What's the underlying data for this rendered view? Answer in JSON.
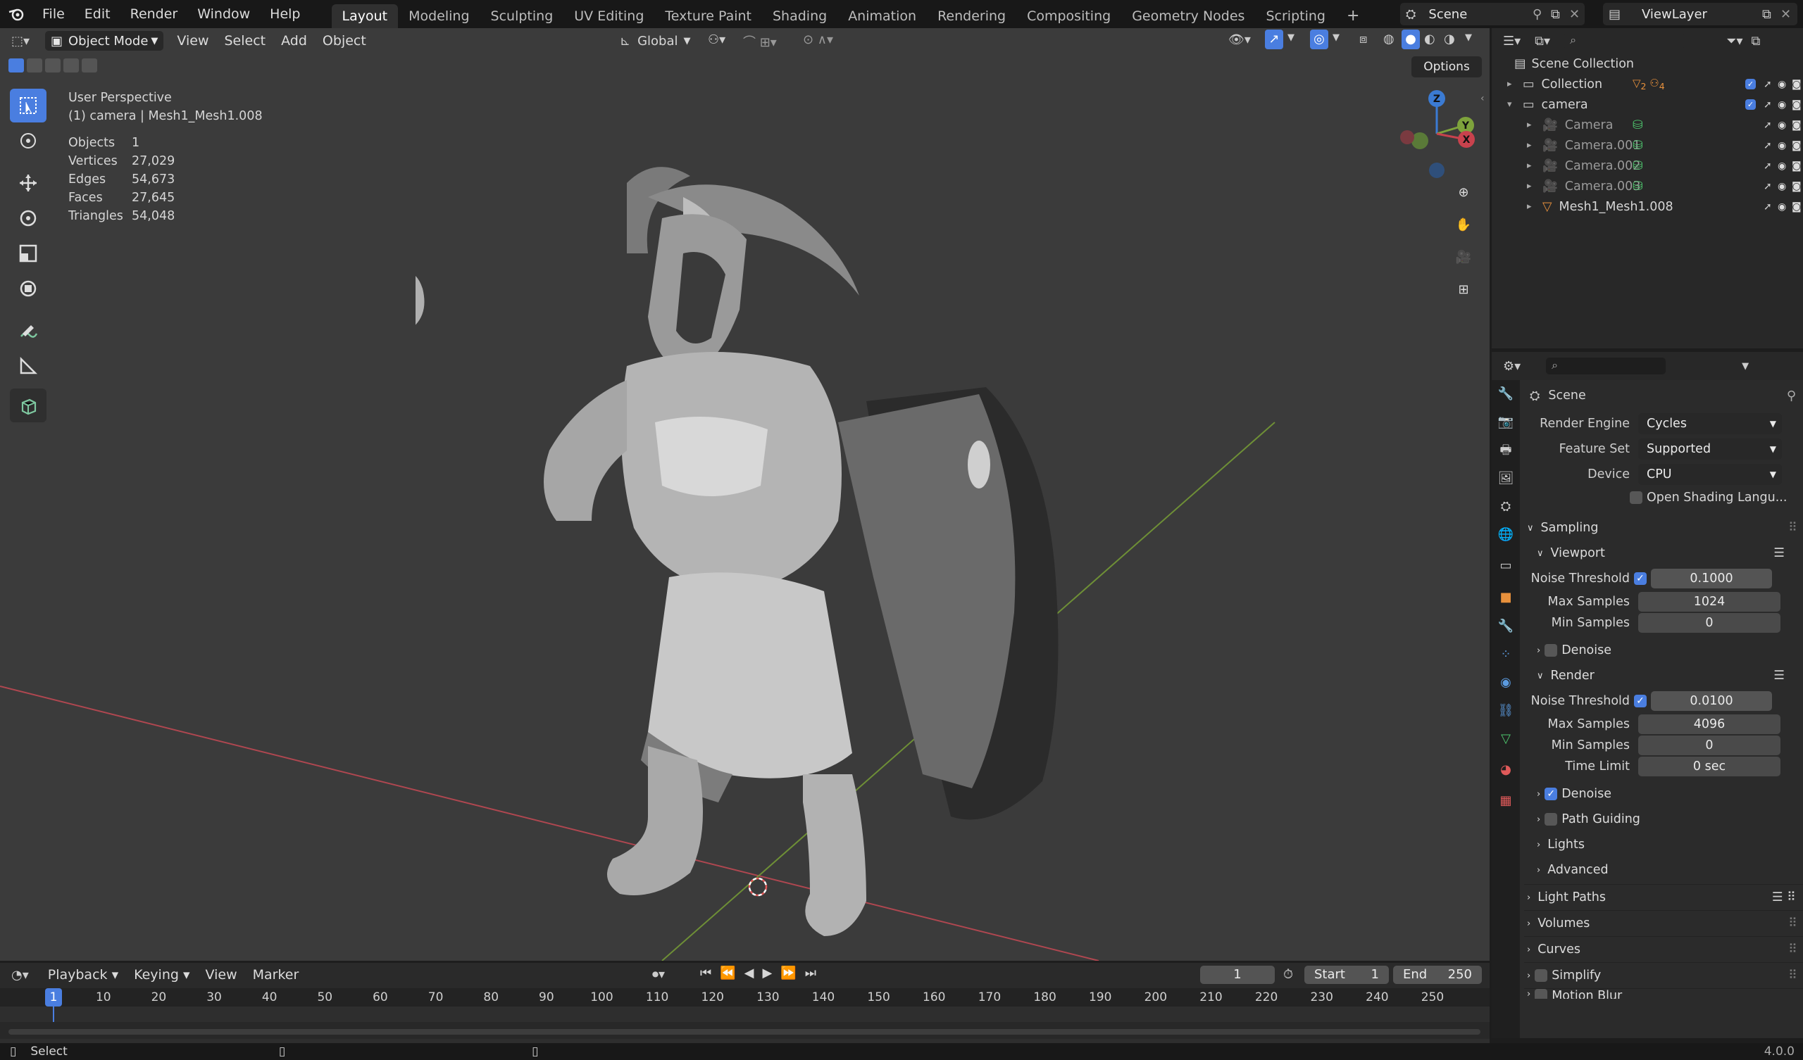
{
  "menu": [
    "File",
    "Edit",
    "Render",
    "Window",
    "Help"
  ],
  "workspaces": [
    "Layout",
    "Modeling",
    "Sculpting",
    "UV Editing",
    "Texture Paint",
    "Shading",
    "Animation",
    "Rendering",
    "Compositing",
    "Geometry Nodes",
    "Scripting"
  ],
  "active_workspace": "Layout",
  "scene_name": "Scene",
  "view_layer": "ViewLayer",
  "viewport": {
    "mode": "Object Mode",
    "menus": [
      "View",
      "Select",
      "Add",
      "Object"
    ],
    "orientation": "Global",
    "options_label": "Options",
    "perspective_label": "User Perspective",
    "object_label": "(1) camera | Mesh1_Mesh1.008",
    "stats": [
      {
        "label": "Objects",
        "value": "1"
      },
      {
        "label": "Vertices",
        "value": "27,029"
      },
      {
        "label": "Edges",
        "value": "54,673"
      },
      {
        "label": "Faces",
        "value": "27,645"
      },
      {
        "label": "Triangles",
        "value": "54,048"
      }
    ],
    "gizmo_axes": [
      "Z",
      "Y",
      "X"
    ]
  },
  "outliner": {
    "root": "Scene Collection",
    "items": [
      {
        "name": "Collection",
        "indent": 0
      },
      {
        "name": "camera",
        "indent": 0
      },
      {
        "name": "Camera",
        "indent": 1
      },
      {
        "name": "Camera.001",
        "indent": 1
      },
      {
        "name": "Camera.002",
        "indent": 1
      },
      {
        "name": "Camera.003",
        "indent": 1
      },
      {
        "name": "Mesh1_Mesh1.008",
        "indent": 1
      }
    ],
    "collection_badges": [
      "2",
      "4"
    ]
  },
  "properties": {
    "context": "Scene",
    "render_engine_label": "Render Engine",
    "render_engine": "Cycles",
    "feature_set_label": "Feature Set",
    "feature_set": "Supported",
    "device_label": "Device",
    "device": "CPU",
    "osl_label": "Open Shading Langu...",
    "sampling": "Sampling",
    "viewport_sub": "Viewport",
    "vp_noise_label": "Noise Threshold",
    "vp_noise": "0.1000",
    "vp_max_label": "Max Samples",
    "vp_max": "1024",
    "vp_min_label": "Min Samples",
    "vp_min": "0",
    "vp_denoise": "Denoise",
    "render_sub": "Render",
    "r_noise_label": "Noise Threshold",
    "r_noise": "0.0100",
    "r_max_label": "Max Samples",
    "r_max": "4096",
    "r_min_label": "Min Samples",
    "r_min": "0",
    "r_time_label": "Time Limit",
    "r_time": "0 sec",
    "r_denoise": "Denoise",
    "path_guiding": "Path Guiding",
    "lights": "Lights",
    "advanced": "Advanced",
    "light_paths": "Light Paths",
    "volumes": "Volumes",
    "curves": "Curves",
    "simplify": "Simplify",
    "motion_blur": "Motion Blur"
  },
  "timeline": {
    "menus": [
      "Playback",
      "Keying",
      "View",
      "Marker"
    ],
    "current_frame": "1",
    "start_label": "Start",
    "start": "1",
    "end_label": "End",
    "end": "250",
    "ticks": [
      "1",
      "10",
      "20",
      "30",
      "40",
      "50",
      "60",
      "70",
      "80",
      "90",
      "100",
      "110",
      "120",
      "130",
      "140",
      "150",
      "160",
      "170",
      "180",
      "190",
      "200",
      "210",
      "220",
      "230",
      "240",
      "250"
    ]
  },
  "status": {
    "left": "Select",
    "version": "4.0.0"
  },
  "colors": {
    "accent_blue": "#4a7ee0",
    "x_axis": "#c8424d",
    "y_axis": "#7ea33c",
    "z_axis": "#3b7bd3"
  }
}
